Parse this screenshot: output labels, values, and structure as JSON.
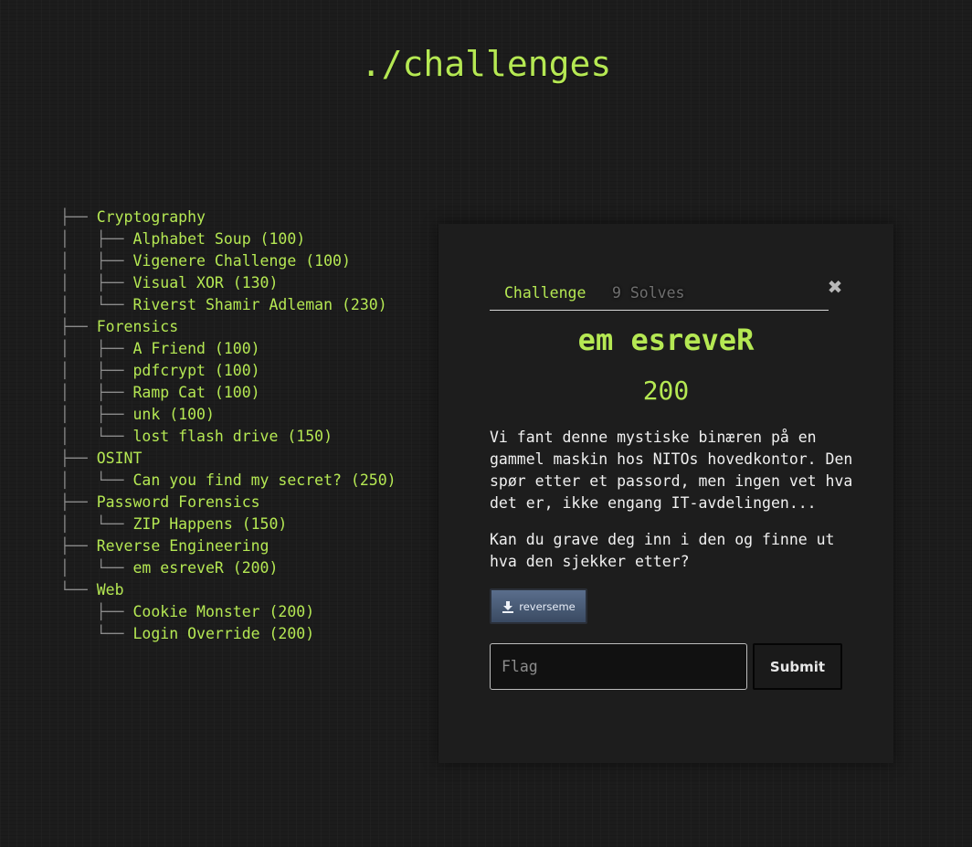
{
  "page": {
    "title": "./challenges"
  },
  "tree": {
    "rows": [
      {
        "prefix": "├── ",
        "label": "Cryptography",
        "type": "category"
      },
      {
        "prefix": "│   ├── ",
        "label": "Alphabet Soup (100)",
        "type": "challenge"
      },
      {
        "prefix": "│   ├── ",
        "label": "Vigenere Challenge (100)",
        "type": "challenge"
      },
      {
        "prefix": "│   ├── ",
        "label": "Visual XOR (130)",
        "type": "challenge"
      },
      {
        "prefix": "│   └── ",
        "label": "Riverst Shamir Adleman (230)",
        "type": "challenge"
      },
      {
        "prefix": "├── ",
        "label": "Forensics",
        "type": "category"
      },
      {
        "prefix": "│   ├── ",
        "label": "A Friend (100)",
        "type": "challenge"
      },
      {
        "prefix": "│   ├── ",
        "label": "pdfcrypt (100)",
        "type": "challenge"
      },
      {
        "prefix": "│   ├── ",
        "label": "Ramp Cat (100)",
        "type": "challenge"
      },
      {
        "prefix": "│   ├── ",
        "label": "unk (100)",
        "type": "challenge"
      },
      {
        "prefix": "│   └── ",
        "label": "lost flash drive (150)",
        "type": "challenge"
      },
      {
        "prefix": "├── ",
        "label": "OSINT",
        "type": "category"
      },
      {
        "prefix": "│   └── ",
        "label": "Can you find my secret? (250)",
        "type": "challenge"
      },
      {
        "prefix": "├── ",
        "label": "Password Forensics",
        "type": "category"
      },
      {
        "prefix": "│   └── ",
        "label": "ZIP Happens (150)",
        "type": "challenge"
      },
      {
        "prefix": "├── ",
        "label": "Reverse Engineering",
        "type": "category"
      },
      {
        "prefix": "│   └── ",
        "label": "em esreveR (200)",
        "type": "challenge"
      },
      {
        "prefix": "└── ",
        "label": "Web",
        "type": "category"
      },
      {
        "prefix": "    ├── ",
        "label": "Cookie Monster (200)",
        "type": "challenge"
      },
      {
        "prefix": "    └── ",
        "label": "Login Override (200)",
        "type": "challenge"
      }
    ]
  },
  "modal": {
    "tabs": {
      "challenge": "Challenge",
      "solves": "9 Solves"
    },
    "close_symbol": "✖",
    "name": "em esreveR",
    "value": "200",
    "description": [
      "Vi fant denne mystiske binæren på en gammel maskin hos NITOs hovedkontor. Den spør etter et passord, men ingen vet hva det er, ikke engang IT-avdelingen...",
      "Kan du grave deg inn i den og finne ut hva den sjekker etter?"
    ],
    "file": {
      "label": "reverseme",
      "icon": "download-icon"
    },
    "flag_input": {
      "placeholder": "Flag",
      "value": ""
    },
    "submit_label": "Submit"
  },
  "colors": {
    "accent": "#b5e853",
    "background": "#1c1c1c",
    "panel": "#1d1d1d",
    "tree_lines": "#8a8a8a",
    "file_button": "#4a5c78"
  }
}
